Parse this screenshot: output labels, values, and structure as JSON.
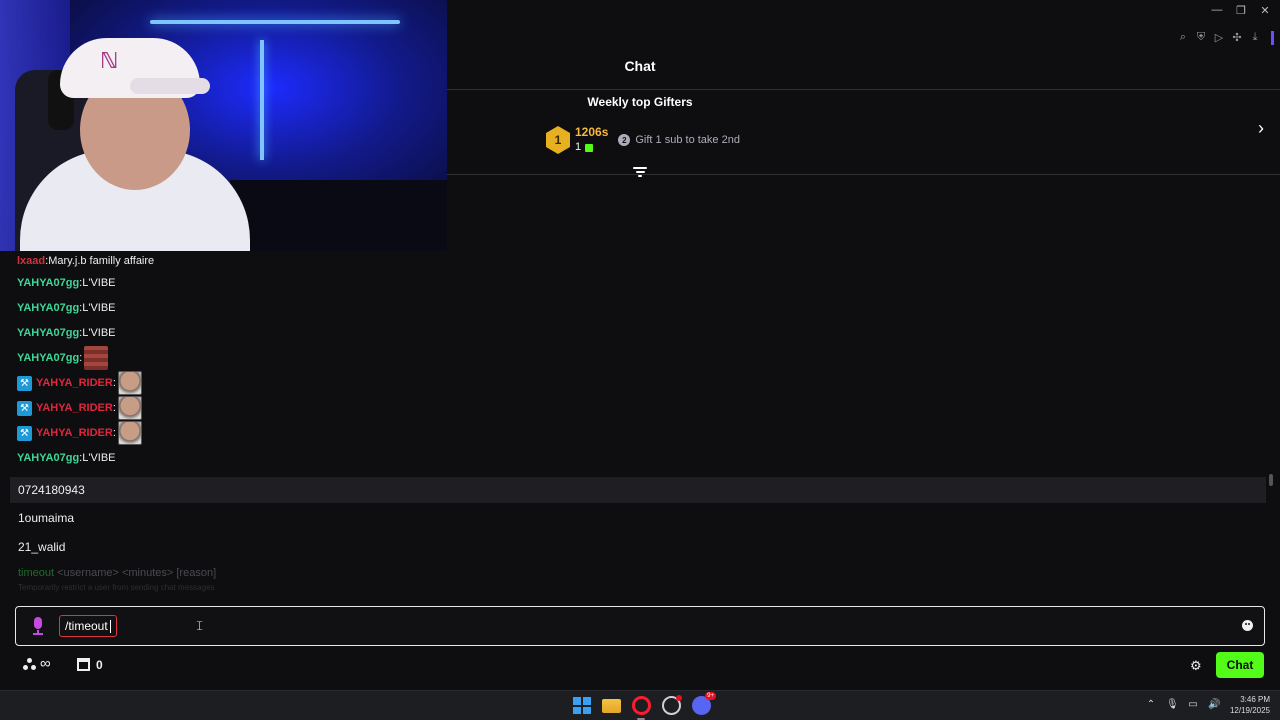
{
  "header": {
    "title": "Chat"
  },
  "gifters": {
    "title": "Weekly top Gifters",
    "top": {
      "rank": "1",
      "name": "1206s",
      "count": "1"
    },
    "next_text": "Gift 1 sub to take 2nd",
    "next_rank": "2"
  },
  "messages": [
    {
      "user": "lxaad",
      "sep": ":",
      "text": " Mary.j.b familly affaire",
      "color": "#d1323f",
      "mod": false,
      "emote": null
    },
    {
      "user": "YAHYA07gg",
      "sep": ":",
      "text": " L'VIBE",
      "color": "#3fd699",
      "mod": false,
      "emote": null
    },
    {
      "user": "YAHYA07gg",
      "sep": ":",
      "text": " L'VIBE",
      "color": "#3fd699",
      "mod": false,
      "emote": null
    },
    {
      "user": "YAHYA07gg",
      "sep": ":",
      "text": " L'VIBE",
      "color": "#3fd699",
      "mod": false,
      "emote": null
    },
    {
      "user": "YAHYA07gg",
      "sep": ":",
      "text": "",
      "color": "#3fd699",
      "mod": false,
      "emote": "brick-emote"
    },
    {
      "user": "YAHYA_RIDER",
      "sep": ":",
      "text": "",
      "color": "#e0263d",
      "mod": true,
      "emote": "face-emote"
    },
    {
      "user": "YAHYA_RIDER",
      "sep": ":",
      "text": "",
      "color": "#e0263d",
      "mod": true,
      "emote": "face-emote"
    },
    {
      "user": "YAHYA_RIDER",
      "sep": ":",
      "text": "",
      "color": "#e0263d",
      "mod": true,
      "emote": "face-emote"
    },
    {
      "user": "YAHYA07gg",
      "sep": ":",
      "text": " L'VIBE",
      "color": "#3fd699",
      "mod": false,
      "emote": null
    }
  ],
  "suggestions": {
    "items": [
      "0724180943",
      "1oumaima",
      "21_walid"
    ],
    "hint_cmd": "timeout",
    "hint_args": " <username> <minutes> [reason]",
    "hint_desc": "Temporarily restrict a user from sending chat messages"
  },
  "input": {
    "command": "/timeout"
  },
  "bottom": {
    "points": "0",
    "chat_button": "Chat"
  },
  "taskbar": {
    "time": "3:46 PM",
    "date": "12/19/2025",
    "discord_badge": "9+"
  },
  "colors": {
    "accent": "#53fc18",
    "gifter_gold": "#f6b93b",
    "user_green": "#3fd699",
    "user_red": "#e0263d"
  }
}
